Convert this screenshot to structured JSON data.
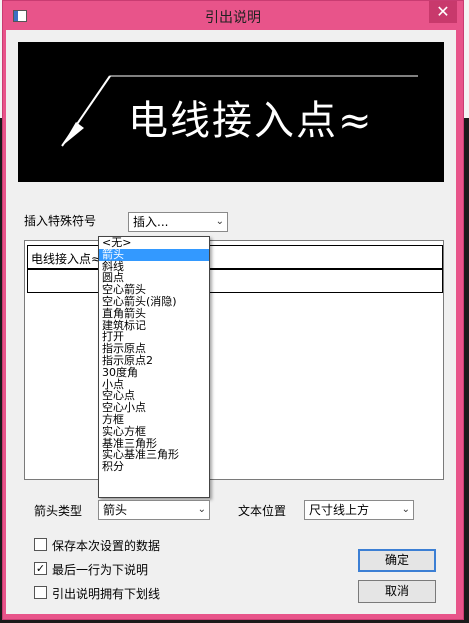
{
  "window": {
    "title": "引出说明",
    "close_glyph": "✕"
  },
  "preview": {
    "text": "电线接入点≈"
  },
  "insert_symbol": {
    "label": "插入特殊符号",
    "combo_value": "插入..."
  },
  "rows": [
    {
      "text": "电线接入点≈"
    },
    {
      "text": ""
    }
  ],
  "arrow_type": {
    "label": "箭头类型",
    "selected": "箭头",
    "options": [
      "<无>",
      "箭头",
      "斜线",
      "圆点",
      "空心箭头",
      "空心箭头(消隐)",
      "直角箭头",
      "建筑标记",
      "打开",
      "指示原点",
      "指示原点2",
      "30度角",
      "小点",
      "空心点",
      "空心小点",
      "方框",
      "实心方框",
      "基准三角形",
      "实心基准三角形",
      "积分"
    ]
  },
  "text_position": {
    "label": "文本位置",
    "selected": "尺寸线上方"
  },
  "checkboxes": [
    {
      "label": "保存本次设置的数据",
      "checked": false
    },
    {
      "label": "最后一行为下说明",
      "checked": true
    },
    {
      "label": "引出说明拥有下划线",
      "checked": false
    }
  ],
  "buttons": {
    "ok": "确定",
    "cancel": "取消"
  },
  "icons": {
    "combo_arrow": "⌄",
    "check_mark": "✓"
  },
  "colors": {
    "titlebar": "#e8548a",
    "close_button": "#c8396c",
    "selection": "#3399ff",
    "default_button_border": "#3c7fd4"
  }
}
